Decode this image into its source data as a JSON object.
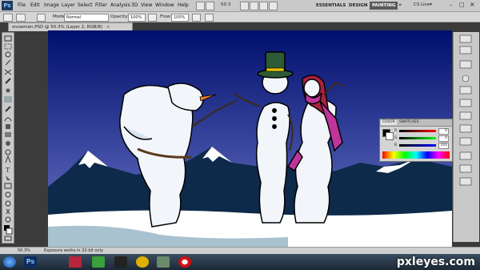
{
  "menu": {
    "logo": "Ps",
    "items": [
      "File",
      "Edit",
      "Image",
      "Layer",
      "Select",
      "Filter",
      "Analysis",
      "3D",
      "View",
      "Window",
      "Help"
    ],
    "zoom_display": "50.3",
    "workspaces": [
      "ESSENTIALS",
      "DESIGN",
      "PAINTING"
    ],
    "active_workspace": "PAINTING",
    "more": "»",
    "cs_live": "CS Live▾"
  },
  "options": {
    "mode_label": "Mode:",
    "mode_value": "Normal",
    "opacity_label": "Opacity:",
    "opacity_value": "100%",
    "flow_label": "Flow:",
    "flow_value": "100%"
  },
  "document": {
    "tab_title": "snowmen.PSD @ 50.3% (Layer 2, RGB/8)",
    "close": "×"
  },
  "color_panel": {
    "tabs": [
      "COLOR",
      "SWATCHES"
    ],
    "active_tab": "COLOR",
    "channels": [
      {
        "label": "R",
        "value": "0"
      },
      {
        "label": "G",
        "value": "0"
      },
      {
        "label": "B",
        "value": "100"
      }
    ]
  },
  "status": {
    "zoom": "50.3%",
    "message": "Exposure works in 32-bit only"
  },
  "taskbar": {
    "ps_label": "Ps",
    "items": [
      "windows-start",
      "photoshop",
      "app-ladybug",
      "app-green",
      "app-inkscape",
      "app-runner",
      "app-gears",
      "app-opera"
    ]
  },
  "watermark": "pxleyes.com",
  "colors": {
    "sky_top": "#000f6e",
    "sky_bottom": "#6d78c8",
    "mountain": "#0d2a4a",
    "snow": "#ffffff",
    "hat": "#2c5b36",
    "scarf": "#c0359a",
    "accent_workspace": "#5a5a5a"
  }
}
